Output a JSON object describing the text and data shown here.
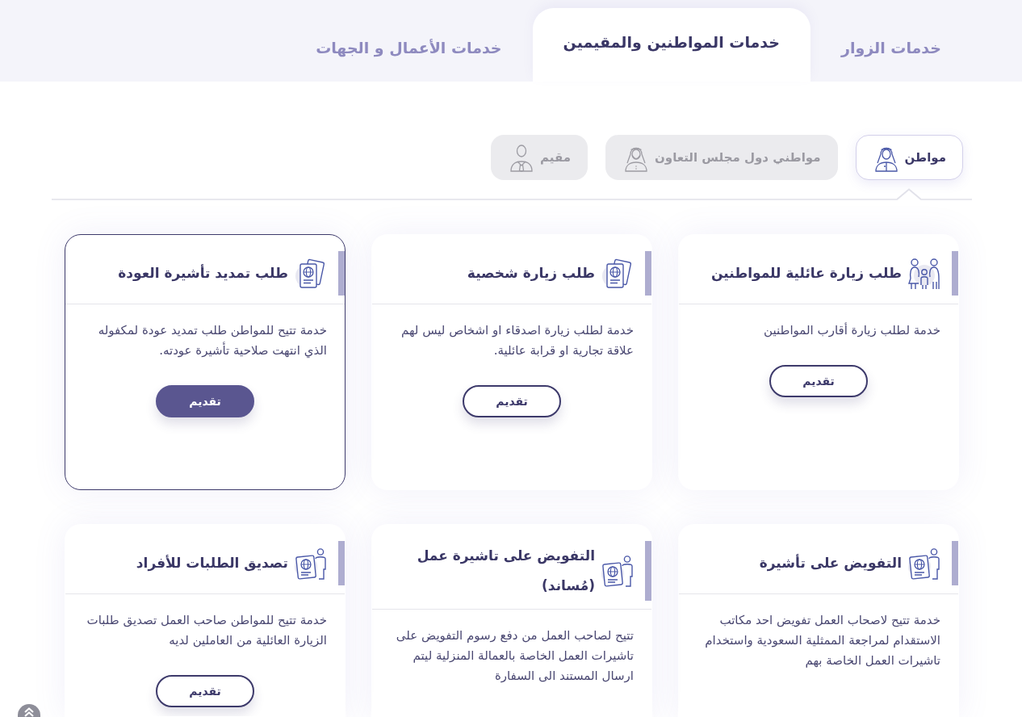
{
  "tabs": [
    {
      "label": "خدمات الزوار",
      "selected": false
    },
    {
      "label": "خدمات المواطنين والمقيمين",
      "selected": true
    },
    {
      "label": "خدمات الأعمال و الجهات",
      "selected": false
    }
  ],
  "audiences": [
    {
      "label": "مواطن",
      "kind": "headdress",
      "selected": true
    },
    {
      "label": "مواطني دول مجلس التعاون",
      "kind": "headdress-beard",
      "selected": false
    },
    {
      "label": "مقيم",
      "kind": "tie",
      "selected": false
    }
  ],
  "services": [
    {
      "kind": "family",
      "title": "طلب زيارة عائلية للمواطنين",
      "description": "خدمة لطلب زيارة أقارب المواطنين",
      "button": "تقديم",
      "highlighted": false
    },
    {
      "kind": "passport",
      "title": "طلب زيارة شخصية",
      "description": "خدمة لطلب زيارة اصدقاء او اشخاص ليس لهم علاقة تجارية او قرابة عائلية.",
      "button": "تقديم",
      "highlighted": false
    },
    {
      "kind": "passport",
      "title": "طلب تمديد تأشيرة العودة",
      "description": "خدمة تتيح للمواطن طلب تمديد عودة لمكفوله الذي انتهت صلاحية تأشيرة عودته.",
      "button": "تقديم",
      "highlighted": true
    },
    {
      "kind": "passport-person",
      "title": "التفويض على تأشيرة",
      "description": "خدمة تتيح لاصحاب العمل تفويض احد مكاتب الاستقدام لمراجعة الممثلية السعودية واستخدام تاشيرات العمل الخاصة بهم",
      "highlighted": false
    },
    {
      "kind": "passport-person",
      "title": "التفويض على تاشيرة عمل (مُساند)",
      "description": "تتيح لصاحب العمل من دفع رسوم التفويض على تاشيرات العمل الخاصة بالعمالة المنزلية ليتم ارسال المستند الى السفارة",
      "highlighted": false
    },
    {
      "kind": "passport-person",
      "title": "تصديق الطلبات للأفراد",
      "description": "خدمة تتيح للمواطن صاحب العمل تصديق طلبات الزيارة العائلية من العاملين لديه",
      "button": "تقديم",
      "highlighted": false
    }
  ]
}
